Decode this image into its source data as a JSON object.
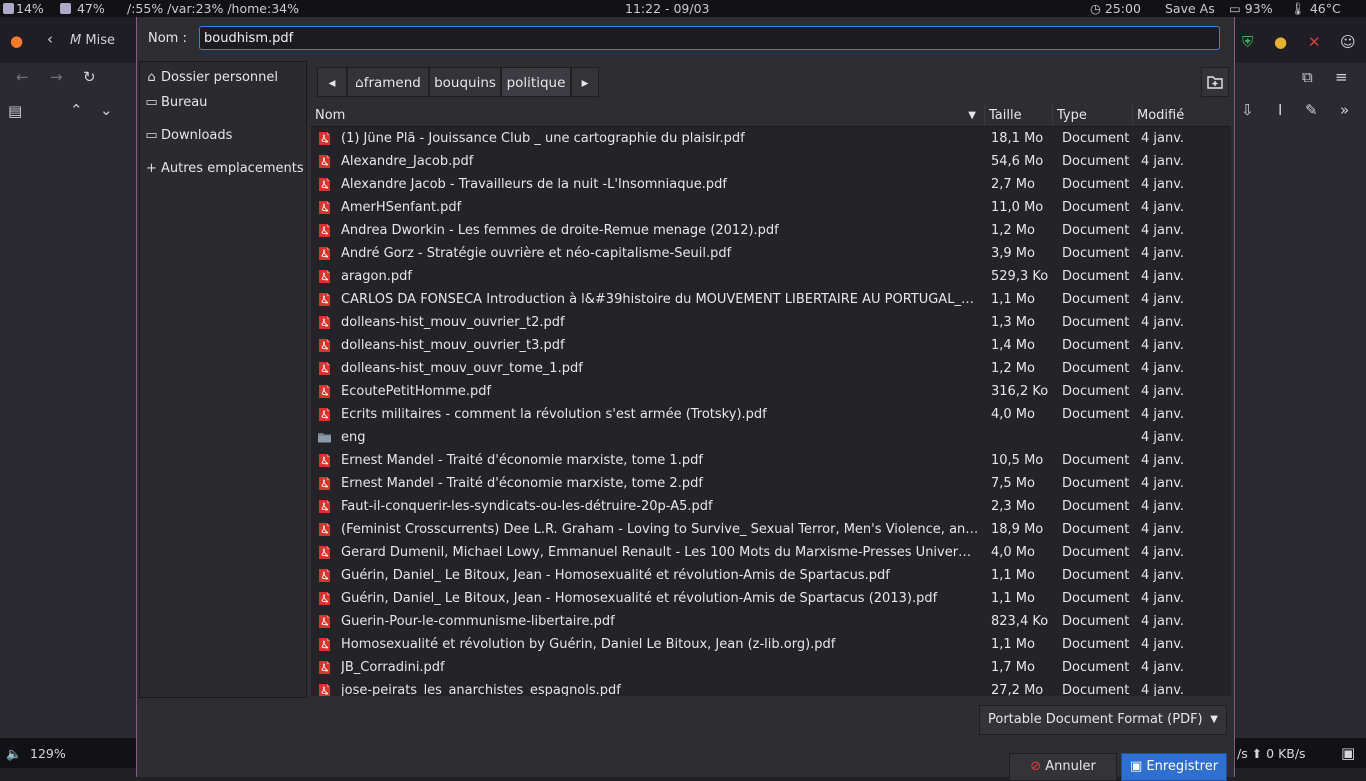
{
  "status": {
    "cpu": "14%",
    "mem": "47%",
    "disk": "/:55% /var:23% /home:34%",
    "clock": "11:22 - 09/03",
    "timer": "25:00",
    "window_title": "Save As",
    "battery": "93%",
    "temp": "46°C"
  },
  "browser": {
    "tab_title": "Mise",
    "zoom": "129%",
    "net": "/s ⬆ 0 KB/s"
  },
  "dialog": {
    "name_label": "Nom :",
    "filename": "boudhism.pdf",
    "places": [
      {
        "label": "Dossier personnel",
        "icon": "home-icon"
      },
      {
        "label": "Bureau",
        "icon": "desktop-icon"
      },
      {
        "label": "Downloads",
        "icon": "folder-icon"
      },
      {
        "label": "Autres emplacements",
        "icon": "plus-icon"
      }
    ],
    "path": [
      "framend",
      "bouquins",
      "politique"
    ],
    "columns": {
      "name": "Nom",
      "size": "Taille",
      "type": "Type",
      "modified": "Modifié"
    },
    "files": [
      {
        "name": "(1) Jüne Plã - Jouissance Club _ une cartographie du plaisir.pdf",
        "size": "18,1 Mo",
        "type": "Document",
        "modified": "4 janv.",
        "kind": "pdf"
      },
      {
        "name": "Alexandre_Jacob.pdf",
        "size": "54,6 Mo",
        "type": "Document",
        "modified": "4 janv.",
        "kind": "pdf"
      },
      {
        "name": "Alexandre Jacob - Travailleurs de la nuit  -L'Insomniaque.pdf",
        "size": "2,7 Mo",
        "type": "Document",
        "modified": "4 janv.",
        "kind": "pdf"
      },
      {
        "name": "AmerHSenfant.pdf",
        "size": "11,0 Mo",
        "type": "Document",
        "modified": "4 janv.",
        "kind": "pdf"
      },
      {
        "name": "Andrea Dworkin - Les femmes de droite-Remue menage (2012).pdf",
        "size": "1,2 Mo",
        "type": "Document",
        "modified": "4 janv.",
        "kind": "pdf"
      },
      {
        "name": "André Gorz - Stratégie ouvrière et néo-capitalisme-Seuil.pdf",
        "size": "3,9 Mo",
        "type": "Document",
        "modified": "4 janv.",
        "kind": "pdf"
      },
      {
        "name": "aragon.pdf",
        "size": "529,3 Ko",
        "type": "Document",
        "modified": "4 janv.",
        "kind": "pdf"
      },
      {
        "name": "CARLOS DA FONSECA Introduction à l&#39histoire du MOUVEMENT LIBERTAIRE AU PORTUGAL_L…",
        "size": "1,1 Mo",
        "type": "Document",
        "modified": "4 janv.",
        "kind": "pdf"
      },
      {
        "name": "dolleans-hist_mouv_ouvrier_t2.pdf",
        "size": "1,3 Mo",
        "type": "Document",
        "modified": "4 janv.",
        "kind": "pdf"
      },
      {
        "name": "dolleans-hist_mouv_ouvrier_t3.pdf",
        "size": "1,4 Mo",
        "type": "Document",
        "modified": "4 janv.",
        "kind": "pdf"
      },
      {
        "name": "dolleans-hist_mouv_ouvr_tome_1.pdf",
        "size": "1,2 Mo",
        "type": "Document",
        "modified": "4 janv.",
        "kind": "pdf"
      },
      {
        "name": "EcoutePetitHomme.pdf",
        "size": "316,2 Ko",
        "type": "Document",
        "modified": "4 janv.",
        "kind": "pdf"
      },
      {
        "name": "Ecrits militaires - comment la révolution s'est armée (Trotsky).pdf",
        "size": "4,0 Mo",
        "type": "Document",
        "modified": "4 janv.",
        "kind": "pdf"
      },
      {
        "name": "eng",
        "size": "",
        "type": "",
        "modified": "4 janv.",
        "kind": "folder"
      },
      {
        "name": "Ernest Mandel - Traité d'économie marxiste, tome 1.pdf",
        "size": "10,5 Mo",
        "type": "Document",
        "modified": "4 janv.",
        "kind": "pdf"
      },
      {
        "name": "Ernest Mandel - Traité d'économie marxiste, tome 2.pdf",
        "size": "7,5 Mo",
        "type": "Document",
        "modified": "4 janv.",
        "kind": "pdf"
      },
      {
        "name": "Faut-il-conquerir-les-syndicats-ou-les-détruire-20p-A5.pdf",
        "size": "2,3 Mo",
        "type": "Document",
        "modified": "4 janv.",
        "kind": "pdf"
      },
      {
        "name": "(Feminist Crosscurrents) Dee L.R. Graham - Loving to Survive_ Sexual Terror, Men's Violence, an…",
        "size": "18,9 Mo",
        "type": "Document",
        "modified": "4 janv.",
        "kind": "pdf"
      },
      {
        "name": "Gerard Dumenil, Michael Lowy, Emmanuel Renault - Les 100 Mots du Marxisme-Presses Univer…",
        "size": "4,0 Mo",
        "type": "Document",
        "modified": "4 janv.",
        "kind": "pdf"
      },
      {
        "name": "Guérin, Daniel_ Le Bitoux, Jean - Homosexualité et révolution-Amis de Spartacus.pdf",
        "size": "1,1 Mo",
        "type": "Document",
        "modified": "4 janv.",
        "kind": "pdf"
      },
      {
        "name": "Guérin, Daniel_ Le Bitoux, Jean - Homosexualité et révolution-Amis de Spartacus (2013).pdf",
        "size": "1,1 Mo",
        "type": "Document",
        "modified": "4 janv.",
        "kind": "pdf"
      },
      {
        "name": "Guerin-Pour-le-communisme-libertaire.pdf",
        "size": "823,4 Ko",
        "type": "Document",
        "modified": "4 janv.",
        "kind": "pdf"
      },
      {
        "name": "Homosexualité et révolution by Guérin, Daniel Le Bitoux, Jean (z-lib.org).pdf",
        "size": "1,1 Mo",
        "type": "Document",
        "modified": "4 janv.",
        "kind": "pdf"
      },
      {
        "name": "JB_Corradini.pdf",
        "size": "1,7 Mo",
        "type": "Document",
        "modified": "4 janv.",
        "kind": "pdf"
      },
      {
        "name": "jose-peirats_les_anarchistes_espagnols.pdf",
        "size": "27,2 Mo",
        "type": "Document",
        "modified": "4 janv.",
        "kind": "pdf"
      }
    ],
    "filter": "Portable Document Format (PDF)",
    "cancel_label": "Annuler",
    "save_label": "Enregistrer"
  }
}
